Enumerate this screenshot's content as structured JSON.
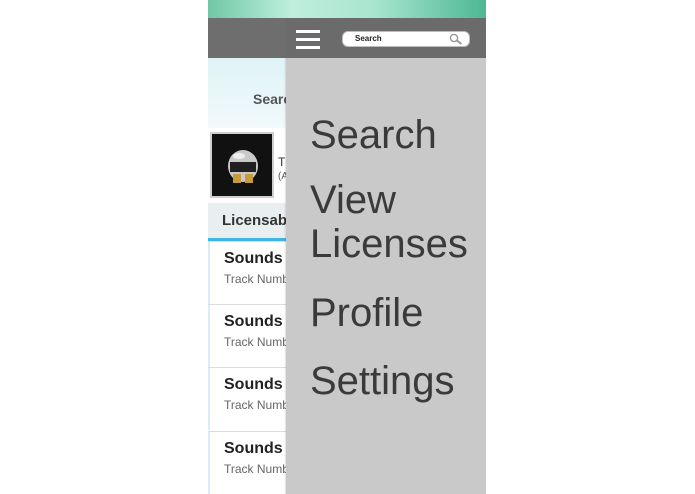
{
  "top_bar": {
    "search_placeholder": "Search",
    "menu_icon": "hamburger-menu-icon",
    "search_icon": "magnifier-icon"
  },
  "background_page": {
    "search_label": "Search",
    "album_title": "T",
    "album_subtitle": "(A",
    "tab_label": "Licensable",
    "list_items": [
      {
        "title": "Sounds L",
        "subtitle": "Track Numb"
      },
      {
        "title": "Sounds L",
        "subtitle": "Track Numb"
      },
      {
        "title": "Sounds L",
        "subtitle": "Track Numb"
      },
      {
        "title": "Sounds L",
        "subtitle": "Track Numb"
      }
    ]
  },
  "drawer": {
    "items": [
      {
        "label": "Search"
      },
      {
        "label": "View"
      },
      {
        "label": "Licenses"
      },
      {
        "label": "Profile"
      },
      {
        "label": "Settings"
      }
    ]
  },
  "colors": {
    "app_bar": "#6b6b6b",
    "drawer_bg": "#c9c9c9",
    "drawer_text": "#3a3a3a",
    "tab_accent": "#40b4e5"
  }
}
